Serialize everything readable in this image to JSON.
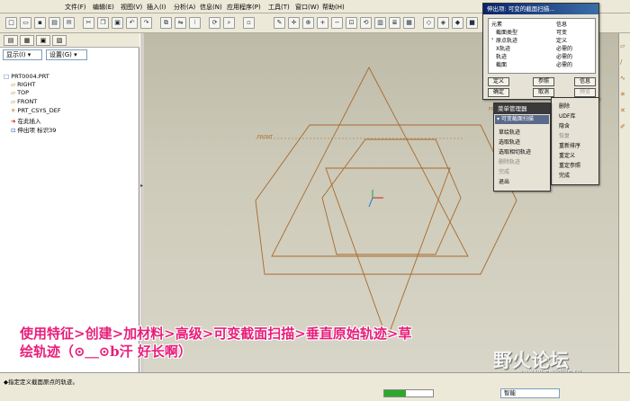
{
  "menu": [
    "文件(F)",
    "编辑(E)",
    "视图(V)",
    "插入(I)",
    "分析(A)",
    "信息(N)",
    "应用程序(P)",
    "工具(T)",
    "窗口(W)",
    "帮助(H)"
  ],
  "left": {
    "tabs": [
      "▤",
      "▦",
      "▣",
      "▧"
    ],
    "show_label": "显示(I) ▾",
    "settings_label": "设置(G) ▾",
    "tree": [
      {
        "icon": "□",
        "label": "PRT0004.PRT"
      },
      {
        "icon": "▱",
        "label": "RIGHT"
      },
      {
        "icon": "▱",
        "label": "TOP"
      },
      {
        "icon": "▱",
        "label": "FRONT"
      },
      {
        "icon": "✳",
        "label": "PRT_CSYS_DEF"
      },
      {
        "icon": "➔",
        "label": "在此插入"
      },
      {
        "icon": "⊡",
        "label": "伸出项 标识39"
      }
    ]
  },
  "viewport": {
    "front_label_left": "FRONT",
    "front_label_right": "FRONT"
  },
  "dialog_sweep": {
    "title": "伸出项: 可变的截面扫描...",
    "col_elem": "元素",
    "col_info": "信息",
    "rows": [
      {
        "elem": "截面类型",
        "info": "可变"
      },
      {
        "elem": "原点轨迹",
        "info": "定义"
      },
      {
        "elem": "X轨迹",
        "info": "必需的"
      },
      {
        "elem": "轨迹",
        "info": "必需的"
      },
      {
        "elem": "截面",
        "info": "必需的"
      }
    ],
    "btn_define": "定义",
    "btn_ref": "参照",
    "btn_info": "信息",
    "btn_ok": "确定",
    "btn_cancel": "取消",
    "btn_preview": "预览"
  },
  "dialog_menu": {
    "title": "菜单管理器",
    "header": "▾ 可变截面扫描",
    "items": [
      "草绘轨迹",
      "选取轨迹",
      "选取相切轨迹",
      "删除轨迹",
      "完成",
      "退出"
    ]
  },
  "dialog_side": {
    "items": [
      "删除",
      "UDF库",
      "隐含",
      "恢复",
      "重新排序",
      "重定义",
      "重定参照",
      "完成"
    ]
  },
  "overlay": {
    "line1": "使用特征>创建>加材料>高级>可变截面扫描>垂直原始轨迹>草",
    "line2": "绘轨迹（⊙＿⊙b汗   好长啊）"
  },
  "watermark": {
    "title": "野火论坛",
    "url": "www.proewildfire.cn"
  },
  "status": {
    "message": "◆指定定义截面原点的轨迹。",
    "mode": "智能",
    "progress": 0.45
  }
}
